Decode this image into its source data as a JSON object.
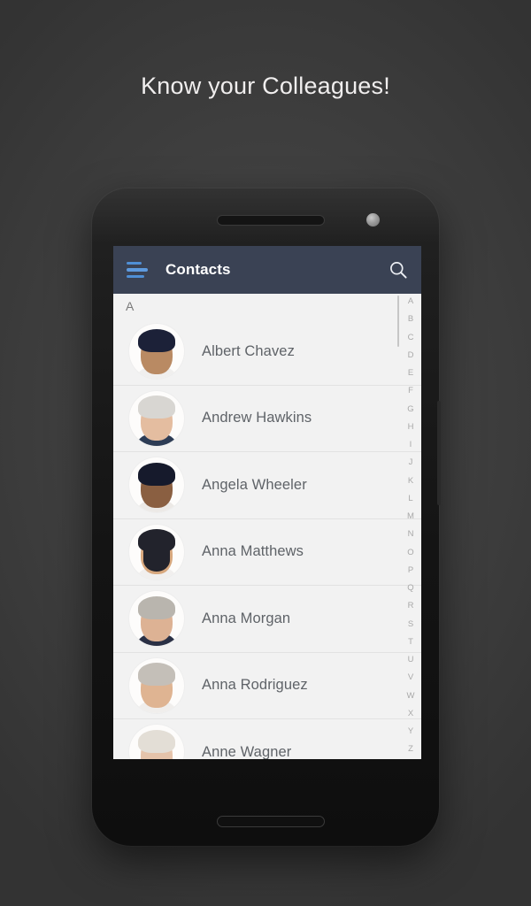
{
  "headline": "Know your Colleagues!",
  "appbar": {
    "title": "Contacts",
    "menu_icon": "hamburger-menu-icon",
    "search_icon": "search-icon",
    "background_color": "#3a4254",
    "menu_icon_color": "#4f8fd6"
  },
  "page_background_color": "#3d3d3d",
  "list": {
    "section_header": "A",
    "contacts": [
      {
        "name": "Albert Chavez",
        "skin": "#b98a63",
        "hair": "#1c2138",
        "body": "#f0efee",
        "beard": false
      },
      {
        "name": "Andrew Hawkins",
        "skin": "#e4bda0",
        "hair": "#d8d6d2",
        "body": "#2d3c55",
        "beard": false
      },
      {
        "name": "Angela Wheeler",
        "skin": "#8a5f41",
        "hair": "#161a2c",
        "body": "#ece9e6",
        "beard": false
      },
      {
        "name": "Anna Matthews",
        "skin": "#d8a87e",
        "hair": "#22232c",
        "body": "#f1efee",
        "beard": true
      },
      {
        "name": "Anna Morgan",
        "skin": "#ddb294",
        "hair": "#b9b5ae",
        "body": "#2a3045",
        "beard": false
      },
      {
        "name": "Anna Rodriguez",
        "skin": "#dfb492",
        "hair": "#c4bfb8",
        "body": "#f0eeec",
        "beard": false
      },
      {
        "name": "Anne Wagner",
        "skin": "#e5c3aa",
        "hair": "#e3ded6",
        "body": "#eeeceb",
        "beard": false
      }
    ]
  },
  "alphabet_index": [
    "A",
    "B",
    "C",
    "D",
    "E",
    "F",
    "G",
    "H",
    "I",
    "J",
    "K",
    "L",
    "M",
    "N",
    "O",
    "P",
    "Q",
    "R",
    "S",
    "T",
    "U",
    "V",
    "W",
    "X",
    "Y",
    "Z"
  ],
  "device": {
    "earpiece": "earpiece-speaker",
    "camera": "front-camera",
    "bottom_speaker": "bottom-speaker",
    "power_button": "power-button"
  }
}
